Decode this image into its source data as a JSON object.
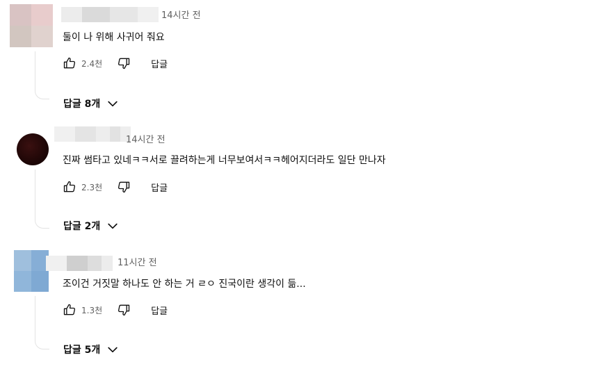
{
  "comments": [
    {
      "time": "14시간 전",
      "text": "둘이 나 위해 사귀어 줘요",
      "likes": "2.4천",
      "reply_label": "답글",
      "replies_label": "답글 8개",
      "avatar_colors": [
        "#d9c3c3",
        "#e8cccc",
        "#d2c6c0",
        "#e0d2ce"
      ],
      "author_blur_colors": [
        "#ececec",
        "#dadada",
        "#e6e6e6",
        "#f0f0f0"
      ]
    },
    {
      "time": "14시간 전",
      "text": "진짜 썸타고 있네ㅋㅋ서로 끌려하는게 너무보여서ㅋㅋ헤어지더라도 일단 만나자",
      "likes": "2.3천",
      "reply_label": "답글",
      "replies_label": "답글 2개",
      "avatar_colors": [
        "#2a0a0a"
      ],
      "author_blur_colors": [
        "#f0f0f0",
        "#e4e4e4",
        "#ededed",
        "#e2e2e2",
        "#eeeeee"
      ]
    },
    {
      "time": "11시간 전",
      "text": "조이건 거짓말 하나도 안 하는 거 ㄹㅇ 진국이란 생각이 듦...",
      "likes": "1.3천",
      "reply_label": "답글",
      "replies_label": "답글 5개",
      "avatar_colors": [
        "#9fbfdd",
        "#86aed6",
        "#90b6da",
        "#7fa9d3"
      ],
      "author_blur_colors": [
        "#f0f0f0",
        "#cfcfcf",
        "#dddddd",
        "#ececec"
      ]
    }
  ]
}
